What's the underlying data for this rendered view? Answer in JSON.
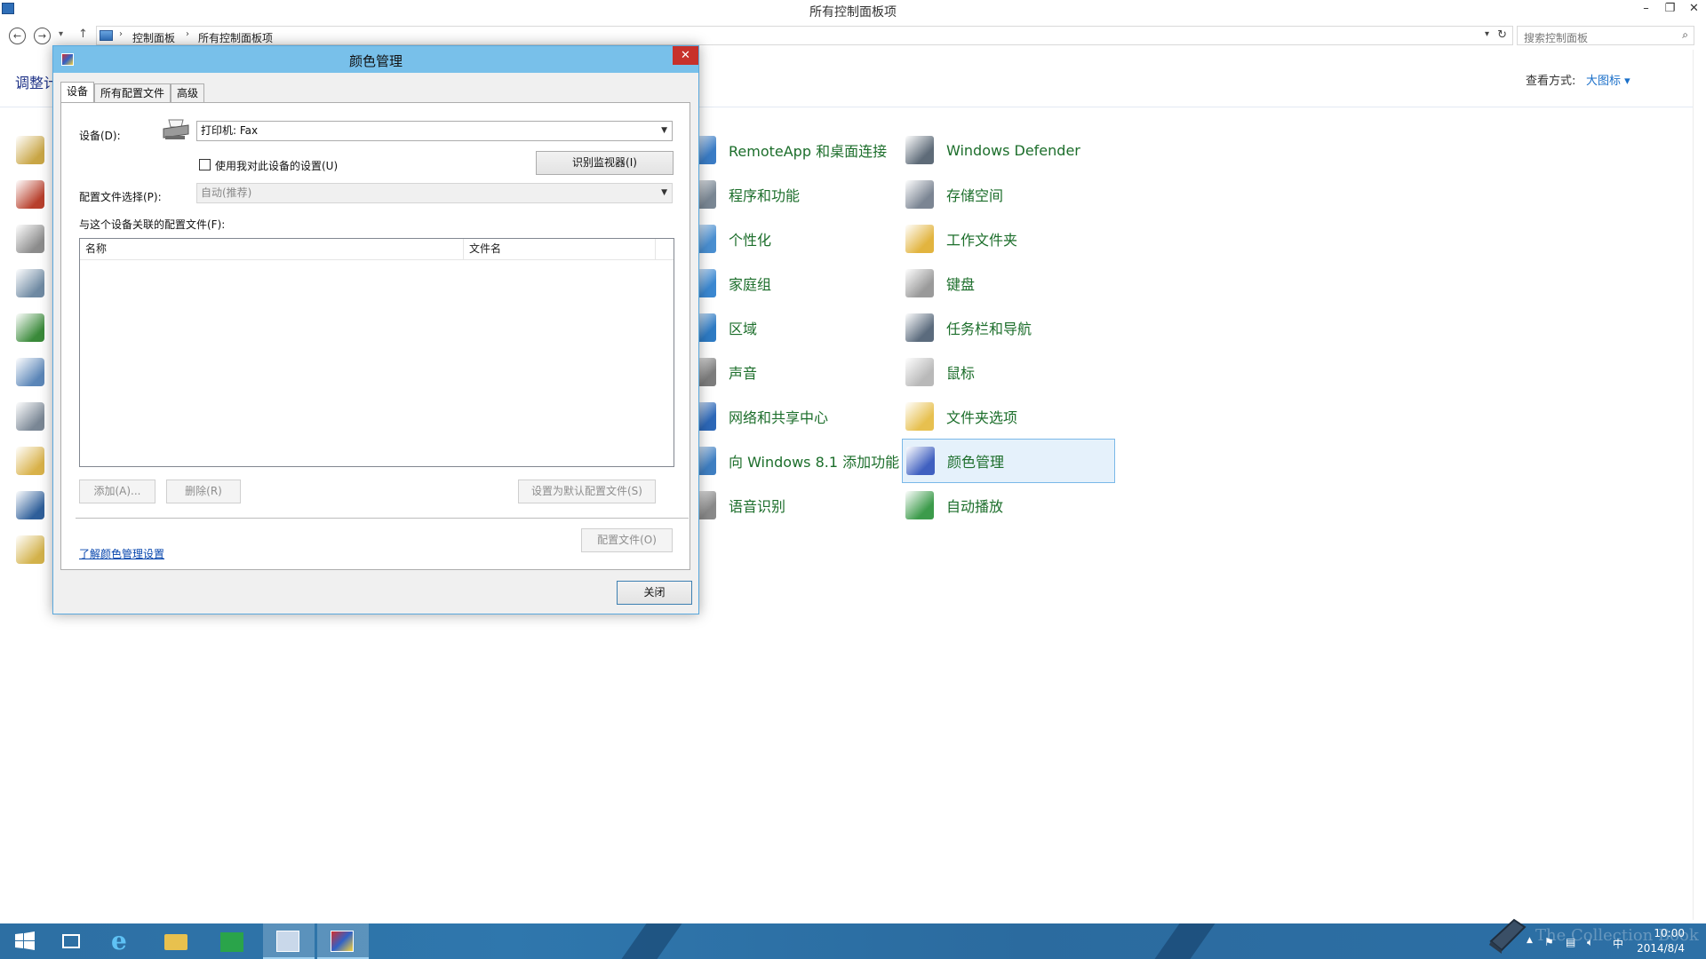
{
  "window": {
    "title": "所有控制面板项",
    "buttons": {
      "minimize": "–",
      "restore": "❐",
      "close": "✕"
    }
  },
  "nav": {
    "back": "←",
    "forward": "→",
    "recent": "▾",
    "up": "↑",
    "breadcrumbs": [
      "控制面板",
      "所有控制面板项"
    ],
    "search_placeholder": "搜索控制面板"
  },
  "main": {
    "heading_partial": "调整计",
    "view_by_label": "查看方式:",
    "view_by_value": "大图标 ▾"
  },
  "items": [
    {
      "label": "RemoteApp 和桌面连接",
      "icon": "remoteapp-icon",
      "color": "#3a7cc5"
    },
    {
      "label": "程序和功能",
      "icon": "programs-icon",
      "color": "#7a8794"
    },
    {
      "label": "个性化",
      "icon": "personalization-icon",
      "color": "#4a8fd1"
    },
    {
      "label": "家庭组",
      "icon": "homegroup-icon",
      "color": "#3b88d1"
    },
    {
      "label": "区域",
      "icon": "region-icon",
      "color": "#2e7bc4"
    },
    {
      "label": "声音",
      "icon": "sound-icon",
      "color": "#7d7d7d"
    },
    {
      "label": "网络和共享中心",
      "icon": "network-icon",
      "color": "#2d68b8"
    },
    {
      "label": "向 Windows 8.1 添加功能",
      "icon": "add-features-icon",
      "color": "#3f7fc2"
    },
    {
      "label": "语音识别",
      "icon": "speech-icon",
      "color": "#8a8a8a"
    },
    {
      "label": "Windows Defender",
      "icon": "defender-icon",
      "color": "#5e6b78"
    },
    {
      "label": "存储空间",
      "icon": "storage-spaces-icon",
      "color": "#7b8593"
    },
    {
      "label": "工作文件夹",
      "icon": "work-folders-icon",
      "color": "#e2b43f"
    },
    {
      "label": "键盘",
      "icon": "keyboard-icon",
      "color": "#9a9a9a"
    },
    {
      "label": "任务栏和导航",
      "icon": "taskbar-nav-icon",
      "color": "#5b6b7d"
    },
    {
      "label": "鼠标",
      "icon": "mouse-icon",
      "color": "#b9b9b9"
    },
    {
      "label": "文件夹选项",
      "icon": "folder-options-icon",
      "color": "#e7c04f"
    },
    {
      "label": "颜色管理",
      "icon": "color-management-icon",
      "color": "#4060c0"
    },
    {
      "label": "自动播放",
      "icon": "autoplay-icon",
      "color": "#3c9b4b"
    }
  ],
  "left_icons": [
    {
      "icon": "credential-manager-icon",
      "color": "#c9a646"
    },
    {
      "icon": "firewall-icon",
      "color": "#b8402d"
    },
    {
      "icon": "printer-icon",
      "color": "#8c8c8c"
    },
    {
      "icon": "admin-tools-icon",
      "color": "#6f8aa3"
    },
    {
      "icon": "action-center-icon",
      "color": "#3a8a3a"
    },
    {
      "icon": "date-time-icon",
      "color": "#5b86b8"
    },
    {
      "icon": "ease-of-access-icon",
      "color": "#7a8795"
    },
    {
      "icon": "file-history-icon",
      "color": "#d9b24a"
    },
    {
      "icon": "display-icon",
      "color": "#2f5f9a"
    },
    {
      "icon": "fonts-icon",
      "color": "#d3b24b"
    }
  ],
  "dialog": {
    "title": "颜色管理",
    "close": "✕",
    "tabs": [
      "设备",
      "所有配置文件",
      "高级"
    ],
    "device_label": "设备(D):",
    "device_value": "打印机: Fax",
    "use_my_settings": "使用我对此设备的设置(U)",
    "identify_monitors": "识别监视器(I)",
    "profile_selection_label": "配置文件选择(P):",
    "profile_selection_value": "自动(推荐)",
    "associated_profiles_label": "与这个设备关联的配置文件(F):",
    "columns": [
      "名称",
      "文件名"
    ],
    "add": "添加(A)...",
    "remove": "删除(R)",
    "set_default": "设置为默认配置文件(S)",
    "profiles": "配置文件(O)",
    "learn_link": "了解颜色管理设置",
    "close_button": "关闭"
  },
  "taskbar": {
    "time": "10:00",
    "date": "2014/8/4",
    "ime": "中",
    "watermark": "The Collection Book"
  }
}
